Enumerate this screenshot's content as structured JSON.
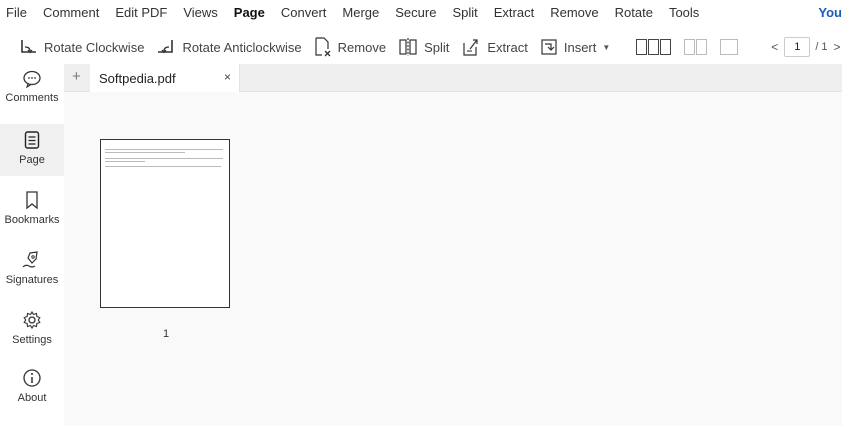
{
  "menu": {
    "items": [
      "File",
      "Comment",
      "Edit PDF",
      "Views",
      "Page",
      "Convert",
      "Merge",
      "Secure",
      "Split",
      "Extract",
      "Remove",
      "Rotate",
      "Tools"
    ],
    "active": "Page",
    "right_label": "You"
  },
  "toolbar": {
    "rotate_cw": "Rotate Clockwise",
    "rotate_ccw": "Rotate Anticlockwise",
    "remove": "Remove",
    "split": "Split",
    "extract": "Extract",
    "insert": "Insert"
  },
  "pager": {
    "current": "1",
    "total": "/ 1"
  },
  "sidebar": {
    "items": [
      {
        "label": "Comments",
        "icon": "comments-icon"
      },
      {
        "label": "Page",
        "icon": "page-icon"
      },
      {
        "label": "Bookmarks",
        "icon": "bookmark-icon"
      },
      {
        "label": "Signatures",
        "icon": "signature-icon"
      },
      {
        "label": "Settings",
        "icon": "gear-icon"
      },
      {
        "label": "About",
        "icon": "info-icon"
      }
    ],
    "active": "Page"
  },
  "tabs": {
    "add_symbol": "+",
    "items": [
      {
        "title": "Softpedia.pdf",
        "close": "×"
      }
    ]
  },
  "document": {
    "page_number": "1"
  },
  "colors": {
    "accent": "#1a5fb4",
    "sidebar_active": "#f0f0f0",
    "tabbar": "#efefef",
    "workspace": "#f9f9f9"
  }
}
